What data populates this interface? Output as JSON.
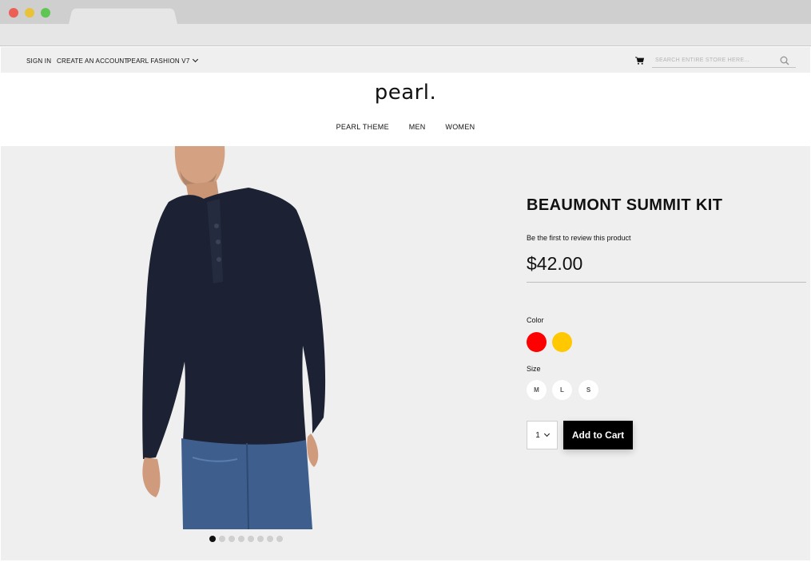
{
  "colors": {
    "swatch_red": "#ff0000",
    "swatch_yellow": "#ffc800",
    "sweater": "#1c2233",
    "jeans": "#3e5f8e",
    "skin": "#d9a98a"
  },
  "utility": {
    "sign_in": "SIGN IN",
    "create_account": "CREATE AN ACCOUNT",
    "store_switcher": "PEARL FASHION V7",
    "search_placeholder": "SEARCH ENTIRE STORE HERE..."
  },
  "header": {
    "logo": "pearl.",
    "nav": [
      "PEARL THEME",
      "MEN",
      "WOMEN"
    ]
  },
  "product": {
    "title": "BEAUMONT SUMMIT KIT",
    "review_text": "Be the first to review this product",
    "price": "$42.00",
    "color_label": "Color",
    "colors": [
      "red",
      "yellow"
    ],
    "size_label": "Size",
    "sizes": [
      "M",
      "L",
      "S"
    ],
    "qty": "1",
    "add_to_cart": "Add to Cart",
    "gallery": {
      "total": 8,
      "active": 1
    }
  }
}
